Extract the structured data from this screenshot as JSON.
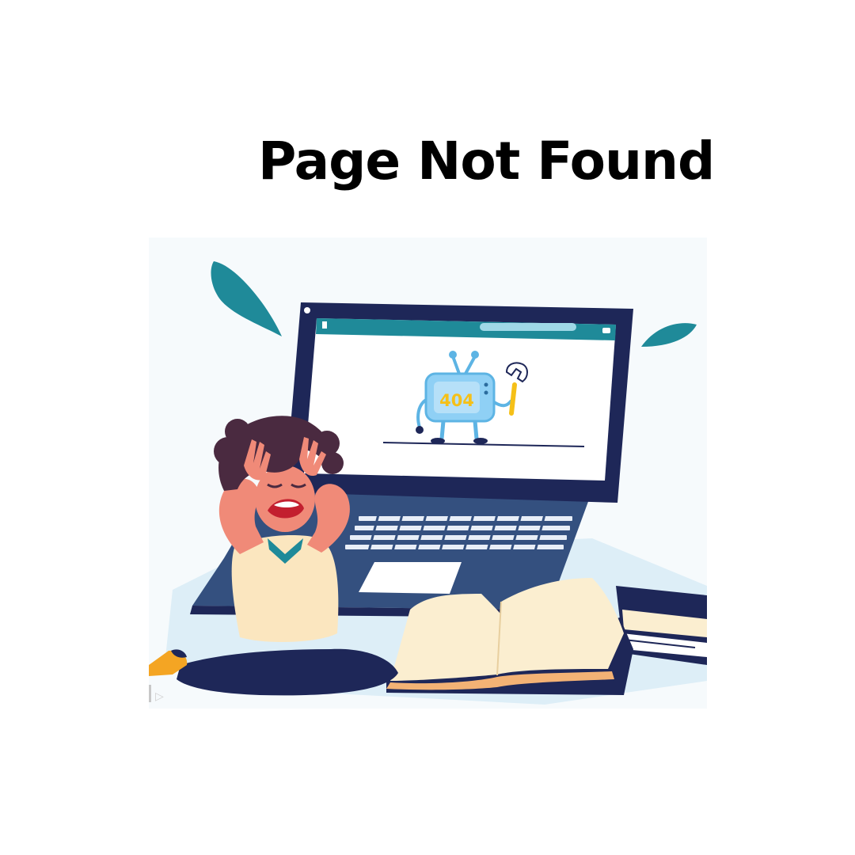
{
  "page": {
    "title": "Page Not Found"
  },
  "illustration": {
    "screen_code": "404",
    "colors": {
      "teal": "#1f8a99",
      "navy": "#1e2758",
      "laptop_blue": "#34507f",
      "robot_blue": "#8fd0f5",
      "robot_text": "#f5c018",
      "skin": "#f08a78",
      "hair": "#4a2a40",
      "shirt": "#fbe6bf",
      "book_page": "#fbeed0",
      "shadow": "#d7ebf5"
    },
    "icons": [
      "laptop-icon",
      "tv-robot-icon",
      "wrench-icon",
      "open-book-icon",
      "stacked-books-icon",
      "leaf-icon",
      "upset-girl-icon"
    ]
  }
}
